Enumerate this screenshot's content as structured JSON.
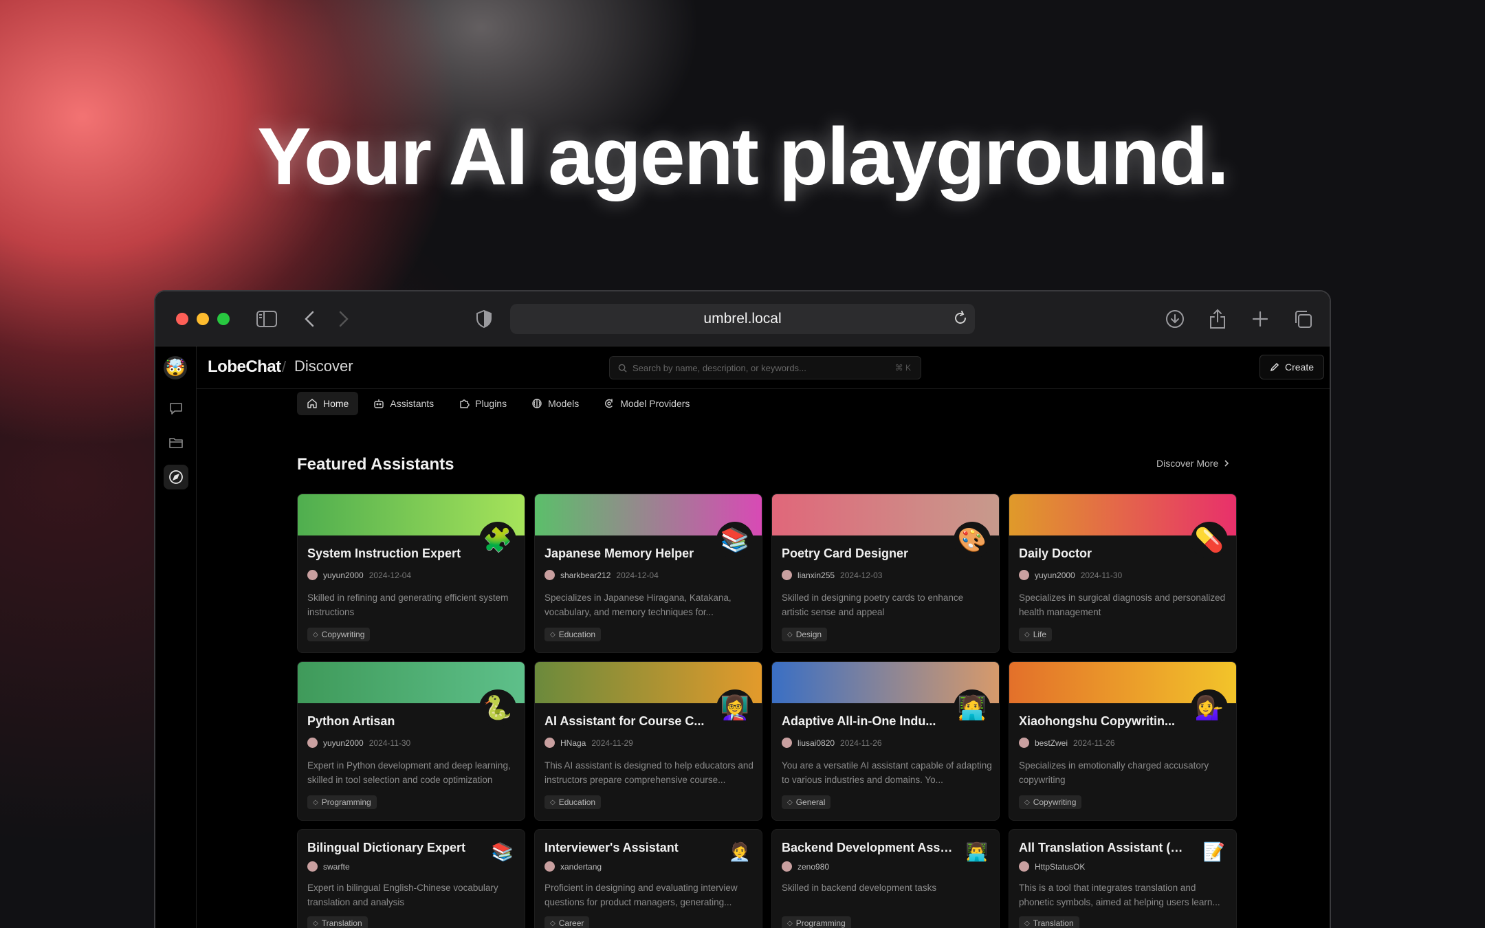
{
  "hero": {
    "title": "Your AI agent playground."
  },
  "browser": {
    "url": "umbrel.local"
  },
  "app": {
    "brand": "LobeChat",
    "separator": "/",
    "page": "Discover",
    "search_placeholder": "Search by name, description, or keywords...",
    "search_shortcut": "⌘ K",
    "create_label": "Create"
  },
  "tabs": [
    {
      "label": "Home",
      "icon": "home-icon",
      "active": true
    },
    {
      "label": "Assistants",
      "icon": "bot-icon"
    },
    {
      "label": "Plugins",
      "icon": "puzzle-icon"
    },
    {
      "label": "Models",
      "icon": "brain-icon"
    },
    {
      "label": "Model Providers",
      "icon": "provider-icon"
    }
  ],
  "section": {
    "title": "Featured Assistants",
    "discover_more": "Discover More"
  },
  "cards": [
    {
      "title": "System Instruction Expert",
      "author": "yuyun2000",
      "date": "2024-12-04",
      "desc": "Skilled in refining and generating efficient system instructions",
      "tag": "Copywriting",
      "emoji": "🧩",
      "banner_colors": [
        "#4fae4f",
        "#a6e35a"
      ]
    },
    {
      "title": "Japanese Memory Helper",
      "author": "sharkbear212",
      "date": "2024-12-04",
      "desc": "Specializes in Japanese Hiragana, Katakana, vocabulary, and memory techniques for...",
      "tag": "Education",
      "emoji": "📚",
      "banner_colors": [
        "#5bbf6a",
        "#d84ab5"
      ]
    },
    {
      "title": "Poetry Card Designer",
      "author": "lianxin255",
      "date": "2024-12-03",
      "desc": "Skilled in designing poetry cards to enhance artistic sense and appeal",
      "tag": "Design",
      "emoji": "🎨",
      "banner_colors": [
        "#e0677a",
        "#c79a8c"
      ]
    },
    {
      "title": "Daily Doctor",
      "author": "yuyun2000",
      "date": "2024-11-30",
      "desc": "Specializes in surgical diagnosis and personalized health management",
      "tag": "Life",
      "emoji": "💊",
      "banner_colors": [
        "#e09a2a",
        "#e8306b"
      ]
    },
    {
      "title": "Python Artisan",
      "author": "yuyun2000",
      "date": "2024-11-30",
      "desc": "Expert in Python development and deep learning, skilled in tool selection and code optimization",
      "tag": "Programming",
      "emoji": "🐍",
      "banner_colors": [
        "#3f9a5a",
        "#5ec08a"
      ]
    },
    {
      "title": "AI Assistant for Course C...",
      "author": "HNaga",
      "date": "2024-11-29",
      "desc": "This AI assistant is designed to help educators and instructors prepare comprehensive course...",
      "tag": "Education",
      "emoji": "👩‍🏫",
      "banner_colors": [
        "#6b8a3c",
        "#e39a2b"
      ]
    },
    {
      "title": "Adaptive All-in-One Indu...",
      "author": "liusai0820",
      "date": "2024-11-26",
      "desc": "You are a versatile AI assistant capable of adapting to various industries and domains. Yo...",
      "tag": "General",
      "emoji": "🧑‍💻",
      "banner_colors": [
        "#3a6fc4",
        "#d79a6b"
      ]
    },
    {
      "title": "Xiaohongshu Copywritin...",
      "author": "bestZwei",
      "date": "2024-11-26",
      "desc": "Specializes in emotionally charged accusatory copywriting",
      "tag": "Copywriting",
      "emoji": "💁‍♀️",
      "banner_colors": [
        "#e3702a",
        "#f2c42a"
      ]
    },
    {
      "title": "Bilingual Dictionary Expert",
      "author": "swarfte",
      "date": "",
      "desc": "Expert in bilingual English-Chinese vocabulary translation and analysis",
      "tag": "Translation",
      "emoji": "📚"
    },
    {
      "title": "Interviewer's Assistant",
      "author": "xandertang",
      "date": "",
      "desc": "Proficient in designing and evaluating interview questions for product managers, generating...",
      "tag": "Career",
      "emoji": "🧑‍💼"
    },
    {
      "title": "Backend Development Assistant",
      "author": "zeno980",
      "date": "",
      "desc": "Skilled in backend development tasks",
      "tag": "Programming",
      "emoji": "👨‍💻"
    },
    {
      "title": "All Translation Assistant (with Ph...",
      "author": "HttpStatusOK",
      "date": "",
      "desc": "This is a tool that integrates translation and phonetic symbols, aimed at helping users learn...",
      "tag": "Translation",
      "emoji": "📝"
    }
  ]
}
